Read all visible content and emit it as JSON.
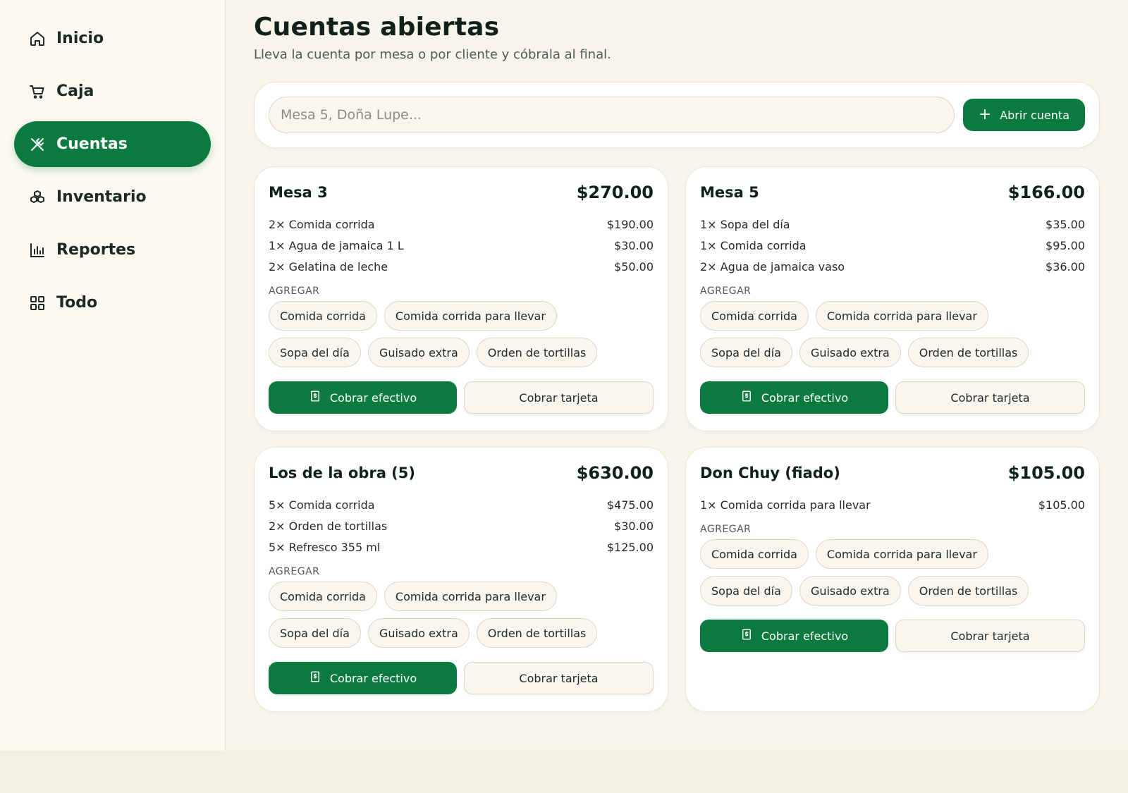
{
  "sidebar": {
    "items": [
      {
        "label": "Inicio",
        "icon": "home-icon"
      },
      {
        "label": "Caja",
        "icon": "cart-icon"
      },
      {
        "label": "Cuentas",
        "icon": "utensils-icon",
        "active": true
      },
      {
        "label": "Inventario",
        "icon": "boxes-icon"
      },
      {
        "label": "Reportes",
        "icon": "bar-chart-icon"
      },
      {
        "label": "Todo",
        "icon": "grid-icon"
      }
    ]
  },
  "header": {
    "title": "Cuentas abiertas",
    "subtitle": "Lleva la cuenta por mesa o por cliente y cóbrala al final."
  },
  "search": {
    "placeholder": "Mesa 5, Doña Lupe...",
    "value": "",
    "open_button": "Abrir cuenta"
  },
  "common": {
    "add_label": "AGREGAR",
    "pay_cash": "Cobrar efectivo",
    "pay_card": "Cobrar tarjeta",
    "chips": [
      "Comida corrida",
      "Comida corrida para llevar",
      "Sopa del día",
      "Guisado extra",
      "Orden de tortillas"
    ]
  },
  "accounts": [
    {
      "name": "Mesa 3",
      "total": "$270.00",
      "lines": [
        {
          "item": "2× Comida corrida",
          "amount": "$190.00"
        },
        {
          "item": "1× Agua de jamaica 1 L",
          "amount": "$30.00"
        },
        {
          "item": "2× Gelatina de leche",
          "amount": "$50.00"
        }
      ]
    },
    {
      "name": "Mesa 5",
      "total": "$166.00",
      "lines": [
        {
          "item": "1× Sopa del día",
          "amount": "$35.00"
        },
        {
          "item": "1× Comida corrida",
          "amount": "$95.00"
        },
        {
          "item": "2× Agua de jamaica vaso",
          "amount": "$36.00"
        }
      ]
    },
    {
      "name": "Los de la obra (5)",
      "total": "$630.00",
      "lines": [
        {
          "item": "5× Comida corrida",
          "amount": "$475.00"
        },
        {
          "item": "2× Orden de tortillas",
          "amount": "$30.00"
        },
        {
          "item": "5× Refresco 355 ml",
          "amount": "$125.00"
        }
      ]
    },
    {
      "name": "Don Chuy (fiado)",
      "total": "$105.00",
      "lines": [
        {
          "item": "1× Comida corrida para llevar",
          "amount": "$105.00"
        }
      ]
    }
  ],
  "colors": {
    "accent": "#0b7a3e",
    "background": "#f7f4e9"
  }
}
